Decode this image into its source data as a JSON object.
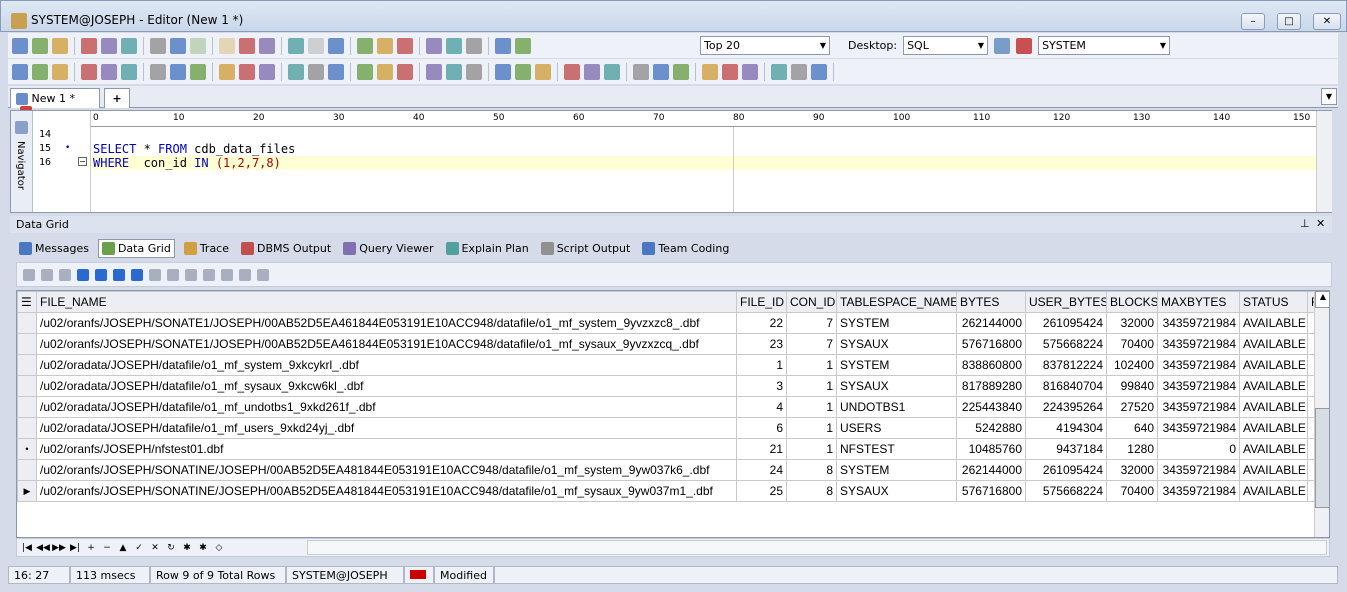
{
  "window": {
    "title": "SYSTEM@JOSEPH - Editor (New 1 *)",
    "min": "–",
    "max": "□",
    "close": "✕"
  },
  "toolbar1": {
    "icons": [
      "connect-icon",
      "new-sql-icon",
      "disconnect-icon",
      "open-icon",
      "load-icon",
      "save-icon",
      "save-as-icon",
      "save-all-icon",
      "disabled1-icon",
      "disabled2-icon",
      "print-icon",
      "execute-sql-icon",
      "find-icon",
      "disabled3-icon",
      "add-window-icon",
      "remove-window-icon",
      "bookmark-icon",
      "back-icon",
      "forward-icon",
      "sql-history-icon",
      "plsql-icon",
      "session-icon",
      "find-object-icon"
    ],
    "top_select": "Top 20",
    "desktop_label": "Desktop:",
    "desktop_select": "SQL",
    "schema_select": "SYSTEM"
  },
  "toolbar2": {
    "icons": [
      "execute-icon",
      "stop-icon",
      "execute-script-icon",
      "explain-plan-icon",
      "format-icon",
      "bind-vars-icon",
      "step-icon",
      "step-into-icon",
      "step-out-icon",
      "run-to-cursor-icon",
      "breakpoint-icon",
      "watch-icon",
      "compile-icon",
      "profiler-icon",
      "trace-icon",
      "copy-icon",
      "paste-icon",
      "clipboard-icon",
      "check-icon",
      "copy-doc-icon",
      "binoculars-icon",
      "find-next-icon",
      "replace-icon",
      "undo-icon",
      "redo-icon",
      "uppercase-icon",
      "lowercase-icon",
      "capitalize-icon",
      "indent-icon",
      "outdent-icon",
      "code-template-icon",
      "comment-icon",
      "record-macro-icon",
      "stop-macro-icon",
      "play-macro-icon",
      "edit-icon"
    ]
  },
  "editor_tab": {
    "label": "New 1 *",
    "add": "+"
  },
  "navigator": "Navigator",
  "ruler": [
    "0",
    "10",
    "20",
    "30",
    "40",
    "50",
    "60",
    "70",
    "80",
    "90",
    "100",
    "110",
    "120",
    "130",
    "140",
    "150"
  ],
  "editor_lines": [
    {
      "num": "14",
      "text": ""
    },
    {
      "num": "15",
      "kw1": "SELECT",
      "mid": " * ",
      "kw2": "FROM",
      "rest": " cdb_data_files"
    },
    {
      "num": "16",
      "kw1": "WHERE",
      "mid": "  con_id ",
      "kw2": "IN",
      "rest": " (1,2,7,8)"
    }
  ],
  "data_grid_title": "Data Grid",
  "result_tabs": [
    "Messages",
    "Data Grid",
    "Trace",
    "DBMS Output",
    "Query Viewer",
    "Explain Plan",
    "Script Output",
    "Team Coding"
  ],
  "grid": {
    "columns": [
      "FILE_NAME",
      "FILE_ID",
      "CON_ID",
      "TABLESPACE_NAME",
      "BYTES",
      "USER_BYTES",
      "BLOCKS",
      "MAXBYTES",
      "STATUS",
      "F"
    ],
    "rows": [
      [
        "/u02/oranfs/JOSEPH/SONATE1/JOSEPH/00AB52D5EA461844E053191E10ACC948/datafile/o1_mf_system_9yvzxzc8_.dbf",
        "22",
        "7",
        "SYSTEM",
        "262144000",
        "261095424",
        "32000",
        "34359721984",
        "AVAILABLE"
      ],
      [
        "/u02/oranfs/JOSEPH/SONATE1/JOSEPH/00AB52D5EA461844E053191E10ACC948/datafile/o1_mf_sysaux_9yvzxzcq_.dbf",
        "23",
        "7",
        "SYSAUX",
        "576716800",
        "575668224",
        "70400",
        "34359721984",
        "AVAILABLE"
      ],
      [
        "/u02/oradata/JOSEPH/datafile/o1_mf_system_9xkcykrl_.dbf",
        "1",
        "1",
        "SYSTEM",
        "838860800",
        "837812224",
        "102400",
        "34359721984",
        "AVAILABLE"
      ],
      [
        "/u02/oradata/JOSEPH/datafile/o1_mf_sysaux_9xkcw6kl_.dbf",
        "3",
        "1",
        "SYSAUX",
        "817889280",
        "816840704",
        "99840",
        "34359721984",
        "AVAILABLE"
      ],
      [
        "/u02/oradata/JOSEPH/datafile/o1_mf_undotbs1_9xkd261f_.dbf",
        "4",
        "1",
        "UNDOTBS1",
        "225443840",
        "224395264",
        "27520",
        "34359721984",
        "AVAILABLE"
      ],
      [
        "/u02/oradata/JOSEPH/datafile/o1_mf_users_9xkd24yj_.dbf",
        "6",
        "1",
        "USERS",
        "5242880",
        "4194304",
        "640",
        "34359721984",
        "AVAILABLE"
      ],
      [
        "/u02/oranfs/JOSEPH/nfstest01.dbf",
        "21",
        "1",
        "NFSTEST",
        "10485760",
        "9437184",
        "1280",
        "0",
        "AVAILABLE"
      ],
      [
        "/u02/oranfs/JOSEPH/SONATINE/JOSEPH/00AB52D5EA481844E053191E10ACC948/datafile/o1_mf_system_9yw037k6_.dbf",
        "24",
        "8",
        "SYSTEM",
        "262144000",
        "261095424",
        "32000",
        "34359721984",
        "AVAILABLE"
      ],
      [
        "/u02/oranfs/JOSEPH/SONATINE/JOSEPH/00AB52D5EA481844E053191E10ACC948/datafile/o1_mf_sysaux_9yw037m1_.dbf",
        "25",
        "8",
        "SYSAUX",
        "576716800",
        "575668224",
        "70400",
        "34359721984",
        "AVAILABLE"
      ]
    ],
    "row_indicators": [
      "",
      "",
      "",
      "",
      "",
      "",
      "•",
      "",
      "▶"
    ]
  },
  "status": {
    "position": "16:  27",
    "time": "113 msecs",
    "rows": "Row 9 of 9 Total Rows",
    "connection": "SYSTEM@JOSEPH",
    "state": "Modified"
  }
}
